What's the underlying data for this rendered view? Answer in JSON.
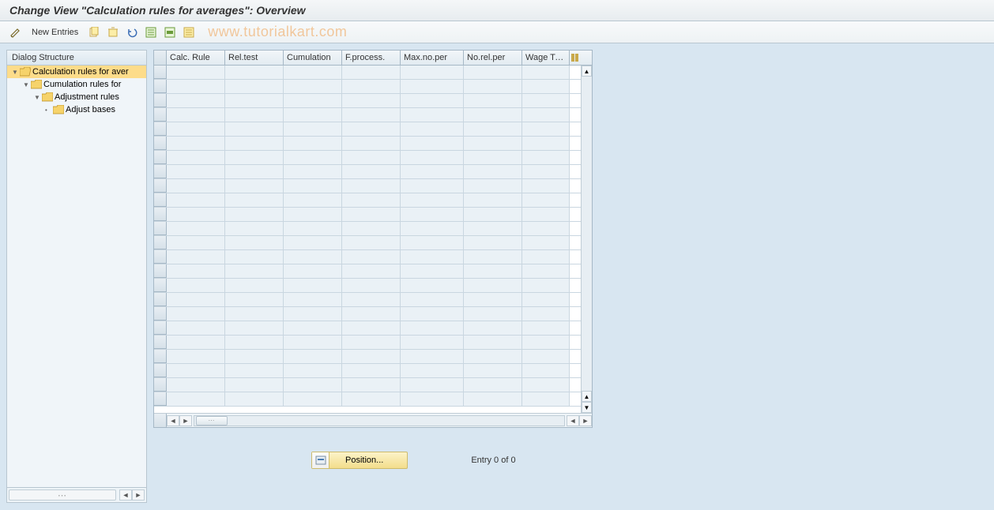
{
  "header": {
    "title": "Change View \"Calculation rules for averages\": Overview"
  },
  "toolbar": {
    "new_entries_label": "New Entries",
    "watermark": "www.tutorialkart.com"
  },
  "sidebar": {
    "header": "Dialog Structure",
    "tree": [
      {
        "label": "Calculation rules for aver",
        "level": 1,
        "open": true,
        "selected": true,
        "expandable": true
      },
      {
        "label": "Cumulation rules for",
        "level": 2,
        "open": false,
        "selected": false,
        "expandable": true
      },
      {
        "label": "Adjustment rules",
        "level": 3,
        "open": false,
        "selected": false,
        "expandable": true
      },
      {
        "label": "Adjust bases",
        "level": 4,
        "open": false,
        "selected": false,
        "expandable": false
      }
    ]
  },
  "table": {
    "columns": [
      "Calc. Rule",
      "Rel.test",
      "Cumulation",
      "F.process.",
      "Max.no.per",
      "No.rel.per",
      "Wage Ty..."
    ],
    "rows": []
  },
  "footer": {
    "position_label": "Position...",
    "entry_text": "Entry 0 of 0"
  }
}
